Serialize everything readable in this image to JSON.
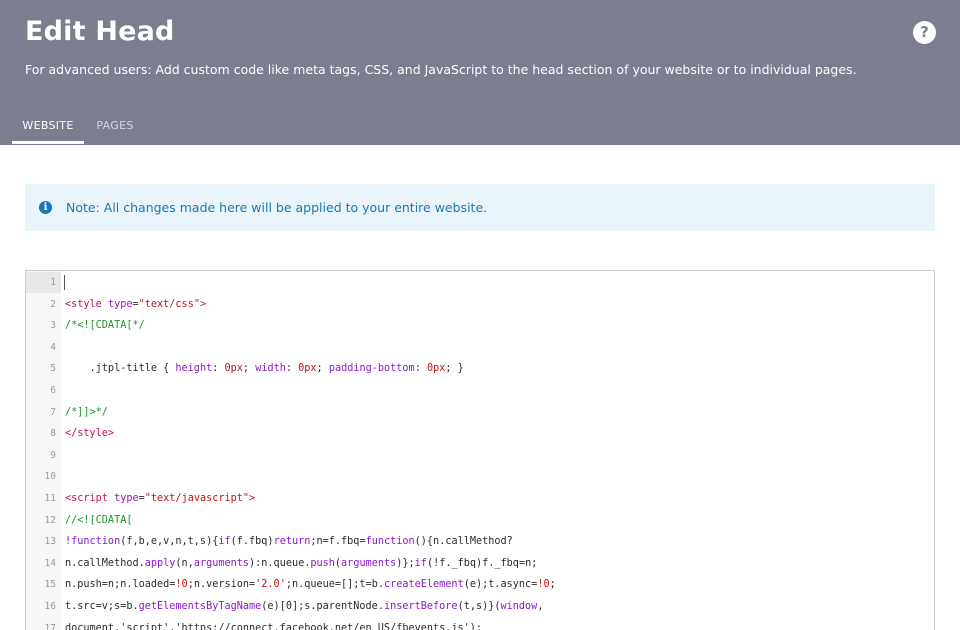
{
  "header": {
    "title": "Edit Head",
    "subtitle": "For advanced users: Add custom code like meta tags, CSS, and JavaScript to the head section of your website or to individual pages.",
    "help_icon": "question-mark-icon",
    "help_label": "?",
    "tabs": [
      {
        "label": "WEBSITE",
        "active": true
      },
      {
        "label": "PAGES",
        "active": false
      }
    ]
  },
  "note": {
    "icon": "info-icon",
    "icon_glyph": "i",
    "text": "Note: All changes made here will be applied to your entire website."
  },
  "editor": {
    "active_line": 1,
    "lines": [
      {
        "num": "1",
        "tokens": []
      },
      {
        "num": "2",
        "tokens": [
          [
            "t-tag",
            "<style "
          ],
          [
            "t-attr",
            "type"
          ],
          [
            "t-pn",
            "="
          ],
          [
            "t-str",
            "\"text/css\""
          ],
          [
            "t-tag",
            ">"
          ]
        ]
      },
      {
        "num": "3",
        "tokens": [
          [
            "t-cm",
            "/*<![CDATA[*/"
          ]
        ]
      },
      {
        "num": "4",
        "tokens": []
      },
      {
        "num": "5",
        "tokens": [
          [
            "t-pn",
            "    .jtpl-title { "
          ],
          [
            "t-prop",
            "height"
          ],
          [
            "t-pn",
            ": "
          ],
          [
            "t-num",
            "0px"
          ],
          [
            "t-pn",
            "; "
          ],
          [
            "t-prop",
            "width"
          ],
          [
            "t-pn",
            ": "
          ],
          [
            "t-num",
            "0px"
          ],
          [
            "t-pn",
            "; "
          ],
          [
            "t-prop",
            "padding-bottom"
          ],
          [
            "t-pn",
            ": "
          ],
          [
            "t-num",
            "0px"
          ],
          [
            "t-pn",
            "; }"
          ]
        ]
      },
      {
        "num": "6",
        "tokens": []
      },
      {
        "num": "7",
        "tokens": [
          [
            "t-cm",
            "/*]]>*/"
          ]
        ]
      },
      {
        "num": "8",
        "tokens": [
          [
            "t-tag",
            "</style>"
          ]
        ]
      },
      {
        "num": "9",
        "tokens": []
      },
      {
        "num": "10",
        "tokens": []
      },
      {
        "num": "11",
        "tokens": [
          [
            "t-tag",
            "<script "
          ],
          [
            "t-attr",
            "type"
          ],
          [
            "t-pn",
            "="
          ],
          [
            "t-str",
            "\"text/javascript\""
          ],
          [
            "t-tag",
            ">"
          ]
        ]
      },
      {
        "num": "12",
        "tokens": [
          [
            "t-cm",
            "//<![CDATA["
          ]
        ]
      },
      {
        "num": "13",
        "tokens": [
          [
            "t-kw",
            "!function"
          ],
          [
            "t-pn",
            "(f,b,e,v,n,t,s){"
          ],
          [
            "t-kw",
            "if"
          ],
          [
            "t-pn",
            "(f.fbq)"
          ],
          [
            "t-kw",
            "return"
          ],
          [
            "t-pn",
            ";n=f.fbq="
          ],
          [
            "t-kw",
            "function"
          ],
          [
            "t-pn",
            "(){n.callMethod?"
          ]
        ]
      },
      {
        "num": "14",
        "tokens": [
          [
            "t-pn",
            "n.callMethod."
          ],
          [
            "t-prop",
            "apply"
          ],
          [
            "t-pn",
            "(n,"
          ],
          [
            "t-kw",
            "arguments"
          ],
          [
            "t-pn",
            "):n.queue."
          ],
          [
            "t-prop",
            "push"
          ],
          [
            "t-pn",
            "("
          ],
          [
            "t-kw",
            "arguments"
          ],
          [
            "t-pn",
            ")};"
          ],
          [
            "t-kw",
            "if"
          ],
          [
            "t-pn",
            "(!f._fbq)f._fbq=n;"
          ]
        ]
      },
      {
        "num": "15",
        "tokens": [
          [
            "t-pn",
            "n.push=n;n.loaded="
          ],
          [
            "t-num",
            "!0"
          ],
          [
            "t-pn",
            ";n.version="
          ],
          [
            "t-str",
            "'2.0'"
          ],
          [
            "t-pn",
            ";n.queue=[];t=b."
          ],
          [
            "t-prop",
            "createElement"
          ],
          [
            "t-pn",
            "(e);t.async="
          ],
          [
            "t-num",
            "!0"
          ],
          [
            "t-pn",
            ";"
          ]
        ]
      },
      {
        "num": "16",
        "tokens": [
          [
            "t-pn",
            "t.src=v;s=b."
          ],
          [
            "t-prop",
            "getElementsByTagName"
          ],
          [
            "t-pn",
            "(e)[0];s.parentNode."
          ],
          [
            "t-prop",
            "insertBefore"
          ],
          [
            "t-pn",
            "(t,s)}("
          ],
          [
            "t-kw",
            "window"
          ],
          [
            "t-pn",
            ","
          ]
        ]
      },
      {
        "num": "17",
        "tokens": [
          [
            "t-pn",
            "document,'script','https://connect.facebook.net/en_US/fbevents.js');"
          ]
        ]
      }
    ]
  }
}
